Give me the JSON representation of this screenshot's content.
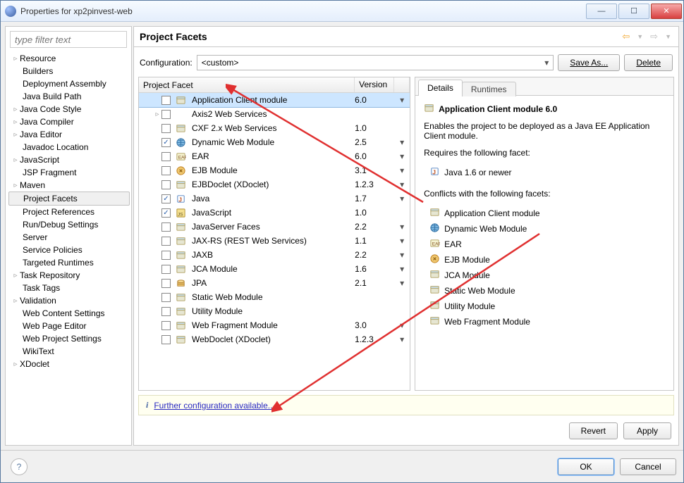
{
  "window": {
    "title": "Properties for xp2pinvest-web"
  },
  "filter_placeholder": "type filter text",
  "nav_tree": [
    {
      "label": "Resource",
      "expand": "▹",
      "indent": false
    },
    {
      "label": "Builders",
      "expand": "",
      "indent": true
    },
    {
      "label": "Deployment Assembly",
      "expand": "",
      "indent": true
    },
    {
      "label": "Java Build Path",
      "expand": "",
      "indent": true
    },
    {
      "label": "Java Code Style",
      "expand": "▹",
      "indent": false
    },
    {
      "label": "Java Compiler",
      "expand": "▹",
      "indent": false
    },
    {
      "label": "Java Editor",
      "expand": "▹",
      "indent": false
    },
    {
      "label": "Javadoc Location",
      "expand": "",
      "indent": true
    },
    {
      "label": "JavaScript",
      "expand": "▹",
      "indent": false
    },
    {
      "label": "JSP Fragment",
      "expand": "",
      "indent": true
    },
    {
      "label": "Maven",
      "expand": "▹",
      "indent": false
    },
    {
      "label": "Project Facets",
      "expand": "",
      "indent": true,
      "selected": true
    },
    {
      "label": "Project References",
      "expand": "",
      "indent": true
    },
    {
      "label": "Run/Debug Settings",
      "expand": "",
      "indent": true
    },
    {
      "label": "Server",
      "expand": "",
      "indent": true
    },
    {
      "label": "Service Policies",
      "expand": "",
      "indent": true
    },
    {
      "label": "Targeted Runtimes",
      "expand": "",
      "indent": true
    },
    {
      "label": "Task Repository",
      "expand": "▹",
      "indent": false
    },
    {
      "label": "Task Tags",
      "expand": "",
      "indent": true
    },
    {
      "label": "Validation",
      "expand": "▹",
      "indent": false
    },
    {
      "label": "Web Content Settings",
      "expand": "",
      "indent": true
    },
    {
      "label": "Web Page Editor",
      "expand": "",
      "indent": true
    },
    {
      "label": "Web Project Settings",
      "expand": "",
      "indent": true
    },
    {
      "label": "WikiText",
      "expand": "",
      "indent": true
    },
    {
      "label": "XDoclet",
      "expand": "▹",
      "indent": false
    }
  ],
  "page_title": "Project Facets",
  "config": {
    "label": "Configuration:",
    "value": "<custom>",
    "save_as": "Save As...",
    "delete": "Delete"
  },
  "facet_columns": {
    "name": "Project Facet",
    "version": "Version"
  },
  "facets": [
    {
      "checked": false,
      "expand": "",
      "label": "Application Client module",
      "ver": "6.0",
      "dd": "▾",
      "selected": true,
      "icon": "app"
    },
    {
      "checked": false,
      "expand": "▹",
      "label": "Axis2 Web Services",
      "ver": "",
      "dd": "",
      "icon": ""
    },
    {
      "checked": false,
      "expand": "",
      "label": "CXF 2.x Web Services",
      "ver": "1.0",
      "dd": "",
      "icon": "app"
    },
    {
      "checked": true,
      "expand": "",
      "label": "Dynamic Web Module",
      "ver": "2.5",
      "dd": "▾",
      "icon": "web"
    },
    {
      "checked": false,
      "expand": "",
      "label": "EAR",
      "ver": "6.0",
      "dd": "▾",
      "icon": "ear"
    },
    {
      "checked": false,
      "expand": "",
      "label": "EJB Module",
      "ver": "3.1",
      "dd": "▾",
      "icon": "ejb"
    },
    {
      "checked": false,
      "expand": "",
      "label": "EJBDoclet (XDoclet)",
      "ver": "1.2.3",
      "dd": "▾",
      "icon": "app"
    },
    {
      "checked": true,
      "expand": "",
      "label": "Java",
      "ver": "1.7",
      "dd": "▾",
      "icon": "java"
    },
    {
      "checked": true,
      "expand": "",
      "label": "JavaScript",
      "ver": "1.0",
      "dd": "",
      "icon": "js"
    },
    {
      "checked": false,
      "expand": "",
      "label": "JavaServer Faces",
      "ver": "2.2",
      "dd": "▾",
      "icon": "app"
    },
    {
      "checked": false,
      "expand": "",
      "label": "JAX-RS (REST Web Services)",
      "ver": "1.1",
      "dd": "▾",
      "icon": "app"
    },
    {
      "checked": false,
      "expand": "",
      "label": "JAXB",
      "ver": "2.2",
      "dd": "▾",
      "icon": "app"
    },
    {
      "checked": false,
      "expand": "",
      "label": "JCA Module",
      "ver": "1.6",
      "dd": "▾",
      "icon": "app"
    },
    {
      "checked": false,
      "expand": "",
      "label": "JPA",
      "ver": "2.1",
      "dd": "▾",
      "icon": "jpa"
    },
    {
      "checked": false,
      "expand": "",
      "label": "Static Web Module",
      "ver": "",
      "dd": "",
      "icon": "app"
    },
    {
      "checked": false,
      "expand": "",
      "label": "Utility Module",
      "ver": "",
      "dd": "",
      "icon": "app"
    },
    {
      "checked": false,
      "expand": "",
      "label": "Web Fragment Module",
      "ver": "3.0",
      "dd": "▾",
      "icon": "app"
    },
    {
      "checked": false,
      "expand": "",
      "label": "WebDoclet (XDoclet)",
      "ver": "1.2.3",
      "dd": "▾",
      "icon": "app"
    }
  ],
  "details": {
    "tab_details": "Details",
    "tab_runtimes": "Runtimes",
    "heading": "Application Client module 6.0",
    "desc": "Enables the project to be deployed as a Java EE Application Client module.",
    "requires_label": "Requires the following facet:",
    "requires": [
      {
        "icon": "java",
        "label": "Java 1.6 or newer"
      }
    ],
    "conflicts_label": "Conflicts with the following facets:",
    "conflicts": [
      {
        "icon": "app",
        "label": "Application Client module"
      },
      {
        "icon": "web",
        "label": "Dynamic Web Module"
      },
      {
        "icon": "ear",
        "label": "EAR"
      },
      {
        "icon": "ejb",
        "label": "EJB Module"
      },
      {
        "icon": "app",
        "label": "JCA Module"
      },
      {
        "icon": "app",
        "label": "Static Web Module"
      },
      {
        "icon": "app",
        "label": "Utility Module"
      },
      {
        "icon": "app",
        "label": "Web Fragment Module"
      }
    ]
  },
  "further_config": "Further configuration available...",
  "btn_revert": "Revert",
  "btn_apply": "Apply",
  "btn_ok": "OK",
  "btn_cancel": "Cancel"
}
